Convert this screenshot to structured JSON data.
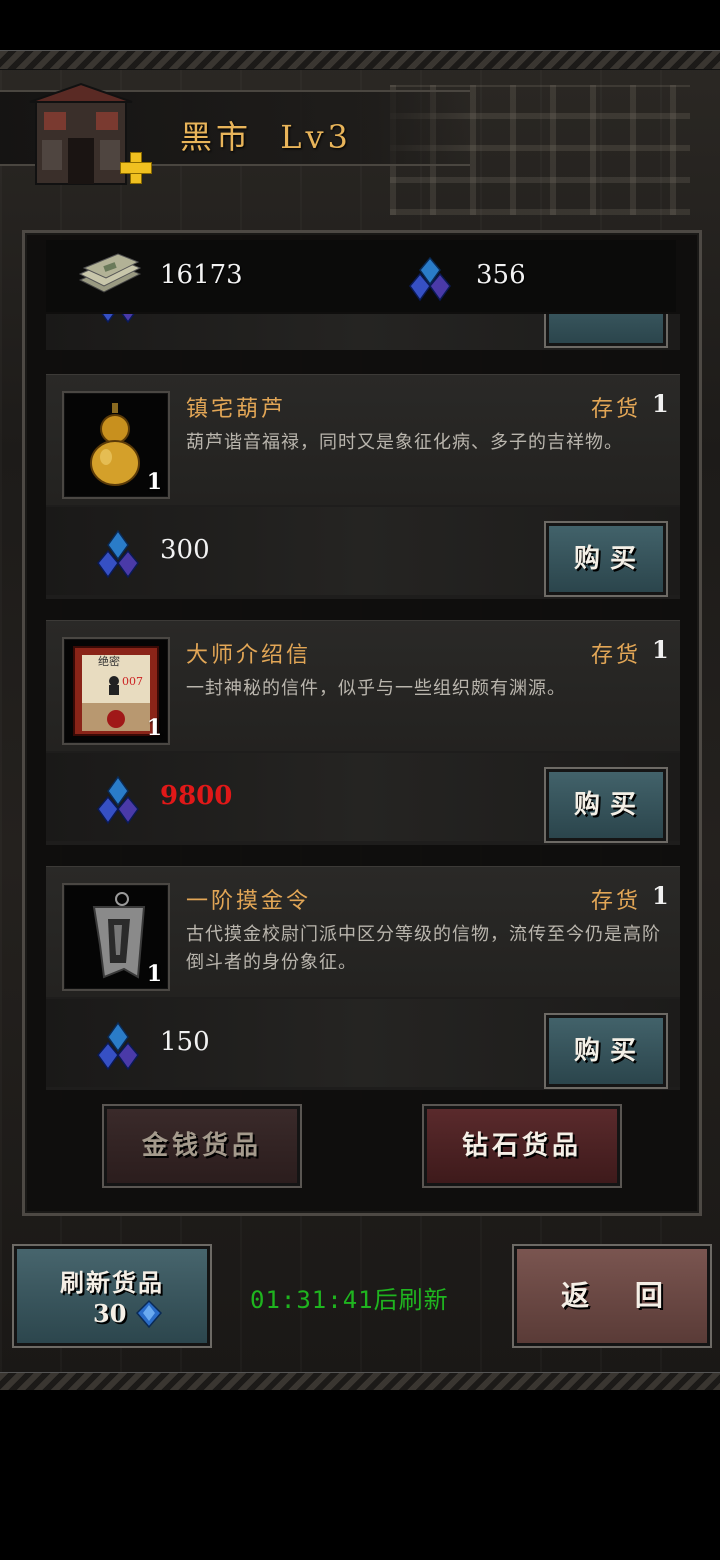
{
  "shop": {
    "title": "黑市",
    "level": "Lv3"
  },
  "currency": {
    "money": "16173",
    "gems": "356"
  },
  "items": [
    {
      "name": "镇宅葫芦",
      "stock_label": "存货",
      "stock": "1",
      "quantity": "1",
      "description": "葫芦谐音福禄，同时又是象征化病、多子的吉祥物。",
      "price": "300",
      "price_affordable": true,
      "buy_label": "购买"
    },
    {
      "name": "大师介绍信",
      "stock_label": "存货",
      "stock": "1",
      "quantity": "1",
      "description": "一封神秘的信件，似乎与一些组织颇有渊源。",
      "price": "9800",
      "price_affordable": false,
      "buy_label": "购买",
      "thumb_text": "绝密",
      "thumb_code": "007"
    },
    {
      "name": "一阶摸金令",
      "stock_label": "存货",
      "stock": "1",
      "quantity": "1",
      "description": "古代摸金校尉门派中区分等级的信物，流传至今仍是高阶倒斗者的身份象征。",
      "price": "150",
      "price_affordable": true,
      "buy_label": "购买"
    }
  ],
  "tabs": {
    "gold": "金钱货品",
    "diamond": "钻石货品"
  },
  "footer": {
    "refresh_label": "刷新货品",
    "refresh_cost": "30",
    "timer": "01:31:41后刷新",
    "back_label": "返 回"
  },
  "colors": {
    "accent_gold": "#e2a656",
    "price_unaffordable": "#e01818",
    "timer_green": "#1fb51f"
  }
}
